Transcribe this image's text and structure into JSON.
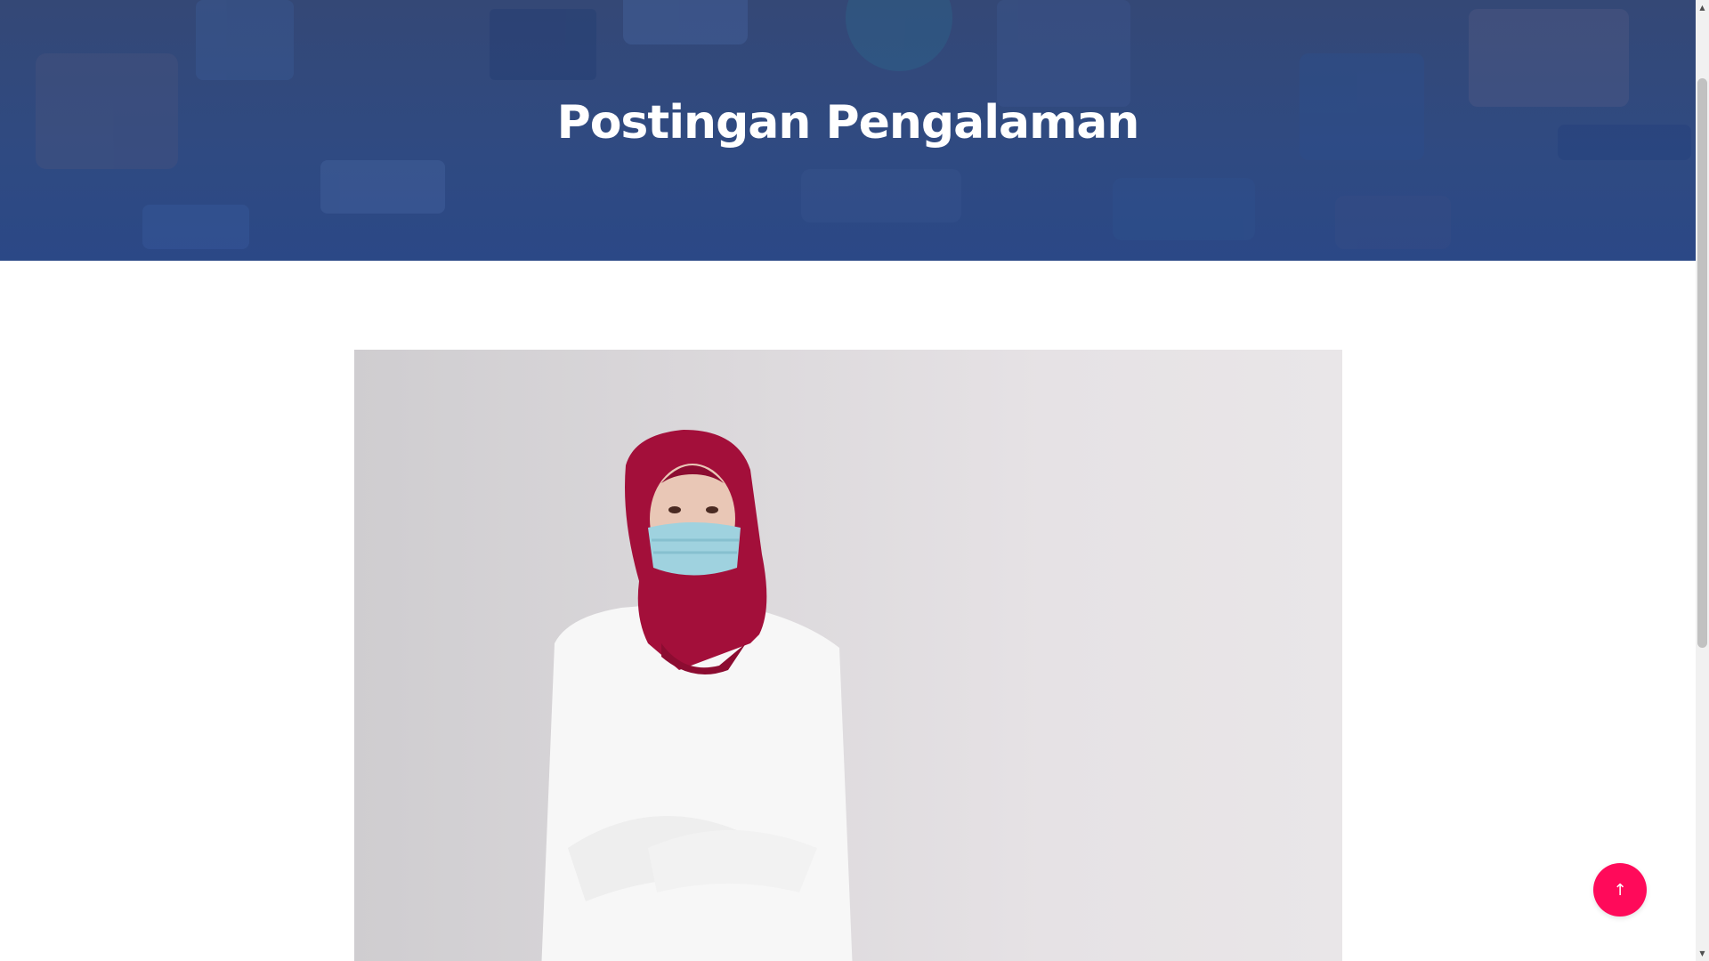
{
  "page": {
    "title": "Postingan Pengalaman"
  },
  "post": {
    "image_icon": "photo-of-woman-in-hijab-and-mask"
  },
  "controls": {
    "back_to_top_icon": "arrow-up-icon",
    "back_to_top_glyph": "↑"
  },
  "scrollbar": {
    "up_glyph": "▲",
    "down_glyph": "▼"
  },
  "colors": {
    "hero_overlay": "#2f4a82",
    "accent": "#ff0a5a",
    "title_text": "#ffffff"
  }
}
